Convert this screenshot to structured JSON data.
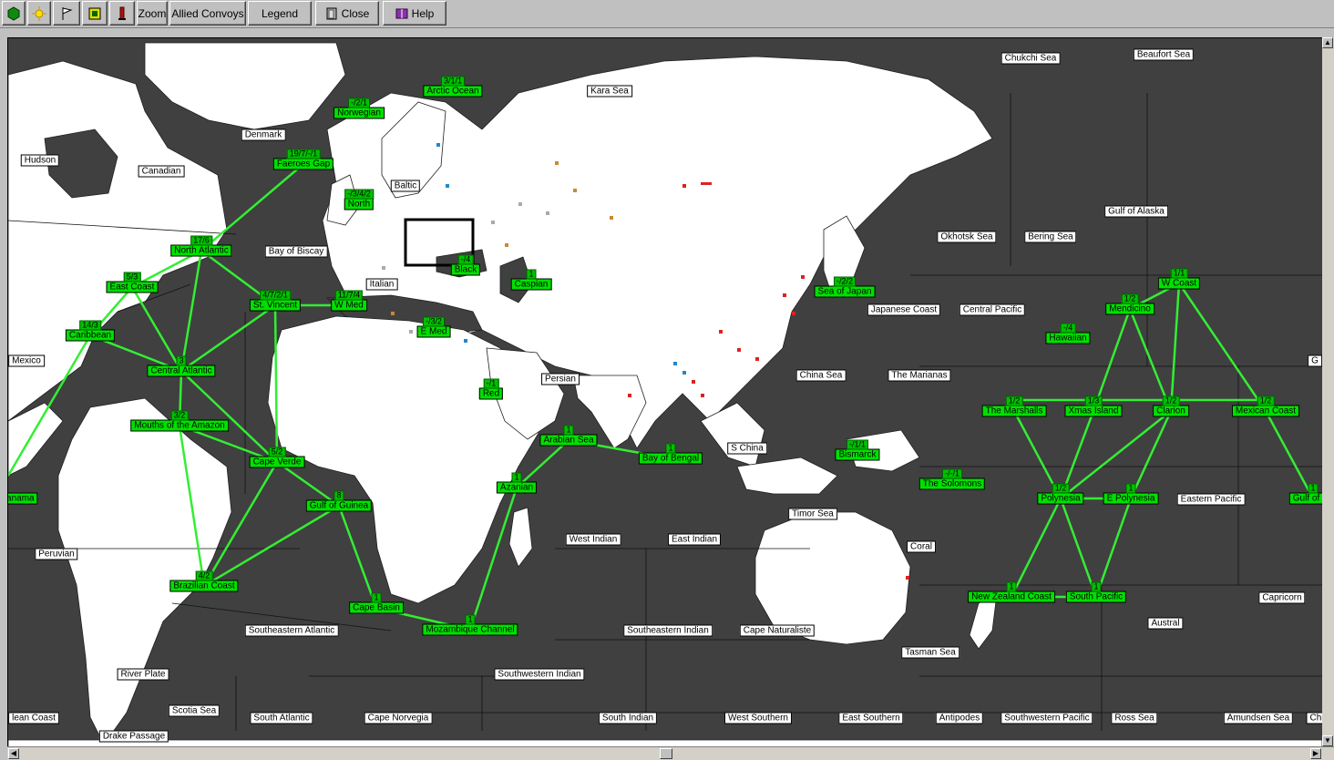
{
  "toolbar": {
    "icon_buttons": [
      {
        "icon": "green-hexagon-icon"
      },
      {
        "icon": "sun-icon"
      },
      {
        "icon": "flag-icon"
      },
      {
        "icon": "chip-icon"
      },
      {
        "icon": "torch-icon"
      }
    ],
    "zoom_label": "Zoom",
    "allied_convoys_label": "Allied Convoys",
    "legend_label": "Legend",
    "close_label": "Close",
    "help_label": "Help"
  },
  "colors": {
    "ocean": "#404040",
    "land": "#ffffff",
    "route": "#33ee33",
    "convoy_box": "#00e000",
    "allied": "#2288cc",
    "axis": "#dd2222",
    "neutral": "#aaaaaa"
  },
  "sea_labels": [
    "Chukchi Sea",
    "Beaufort Sea",
    "Kara Sea",
    "Denmark",
    "Hudson",
    "Canadian",
    "Baltic",
    "Bay of Biscay",
    "Italian",
    "Okhotsk Sea",
    "Bering Sea",
    "Gulf of Alaska",
    "Japanese Coast",
    "Central Pacific",
    "Mexico",
    "G",
    "Persian",
    "China Sea",
    "The Marianas",
    "S China",
    "Timor Sea",
    "Eastern Pacific",
    "Peruvian",
    "West Indian",
    "East Indian",
    "Coral",
    "Capricorn",
    "Southeastern Atlantic",
    "Southeastern Indian",
    "Cape Naturaliste",
    "Austral",
    "Tasman Sea",
    "River Plate",
    "Southwestern Indian",
    "Scotia Sea",
    "lean Coast",
    "South Atlantic",
    "Cape Norvegia",
    "South Indian",
    "West Southern",
    "East Southern",
    "Antipodes",
    "Southwestern Pacific",
    "Ross Sea",
    "Amundsen Sea",
    "Chi",
    "Drake Passage"
  ],
  "convoy_zones": [
    {
      "name": "Arctic Ocean",
      "count": "3/1/1"
    },
    {
      "name": "Norwegian",
      "count": "-/2/1"
    },
    {
      "name": "Faeroes Gap",
      "count": "19/7/-/1"
    },
    {
      "name": "North",
      "count": "-/3/4/2"
    },
    {
      "name": "North Atlantic",
      "count": "17/6"
    },
    {
      "name": "East Coast",
      "count": "5/3"
    },
    {
      "name": "St. Vincent",
      "count": "4/7/2/1"
    },
    {
      "name": "W Med",
      "count": "11/7/4"
    },
    {
      "name": "Black",
      "count": "-/4"
    },
    {
      "name": "Caspian",
      "count": "1"
    },
    {
      "name": "E Med",
      "count": "-/3/2"
    },
    {
      "name": "Caribbean",
      "count": "14/3"
    },
    {
      "name": "Central Atlantic",
      "count": "3"
    },
    {
      "name": "Mouths of the Amazon",
      "count": "3/2"
    },
    {
      "name": "Red",
      "count": "-/1"
    },
    {
      "name": "Arabian Sea",
      "count": "1"
    },
    {
      "name": "Bay of Bengal",
      "count": "1"
    },
    {
      "name": "Cape Verde",
      "count": "5/2"
    },
    {
      "name": "Azanian",
      "count": "1"
    },
    {
      "name": "Gulf of Guinea",
      "count": "8"
    },
    {
      "name": "Brazilian Coast",
      "count": "4/2"
    },
    {
      "name": "Cape Basin",
      "count": "1"
    },
    {
      "name": "Mozambique Channel",
      "count": "1"
    },
    {
      "name": "Sea of Japan",
      "count": "-/2/2"
    },
    {
      "name": "W Coast",
      "count": "1/1"
    },
    {
      "name": "Mendicino",
      "count": "1/2"
    },
    {
      "name": "Hawaiian",
      "count": "-/4"
    },
    {
      "name": "The Marshalls",
      "count": "1/2"
    },
    {
      "name": "Xmas Island",
      "count": "1/3"
    },
    {
      "name": "Clarion",
      "count": "1/2"
    },
    {
      "name": "Mexican Coast",
      "count": "1/2"
    },
    {
      "name": "Bismarck",
      "count": "-/1/1"
    },
    {
      "name": "The Solomons",
      "count": "-/-/1"
    },
    {
      "name": "Polynesia",
      "count": "1/2"
    },
    {
      "name": "E Polynesia",
      "count": "1"
    },
    {
      "name": "Gulf of Pa",
      "count": "1"
    },
    {
      "name": "Panama",
      "count": ""
    },
    {
      "name": "New Zealand Coast",
      "count": "1"
    },
    {
      "name": "South Pacific",
      "count": "1"
    }
  ]
}
